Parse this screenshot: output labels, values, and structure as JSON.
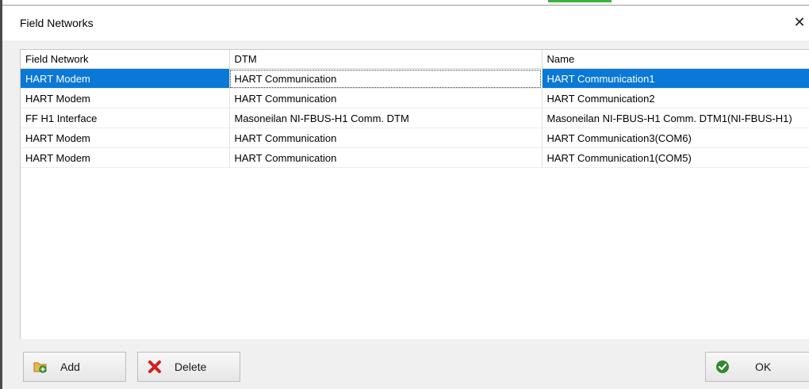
{
  "window": {
    "title": "Field Networks",
    "close_glyph": "✕"
  },
  "table": {
    "columns": [
      "Field Network",
      "DTM",
      "Name"
    ],
    "rows": [
      [
        "HART Modem",
        "HART Communication",
        "HART Communication1"
      ],
      [
        "HART Modem",
        "HART Communication",
        "HART Communication2"
      ],
      [
        "FF H1 Interface",
        "Masoneilan NI-FBUS-H1 Comm. DTM",
        "Masoneilan NI-FBUS-H1 Comm. DTM1(NI-FBUS-H1)"
      ],
      [
        "HART Modem",
        "HART Communication",
        "HART Communication3(COM6)"
      ],
      [
        "HART Modem",
        "HART Communication",
        "HART Communication1(COM5)"
      ]
    ],
    "selected_row": 0
  },
  "buttons": {
    "add_label": "Add",
    "delete_label": "Delete",
    "ok_label": "OK"
  },
  "icons": {
    "add": "folder-add-icon",
    "delete": "red-x-icon",
    "ok": "green-check-icon"
  },
  "colors": {
    "selection": "#0a78d7",
    "ok_icon": "#2f8a2f",
    "delete_icon": "#d21f1f"
  }
}
